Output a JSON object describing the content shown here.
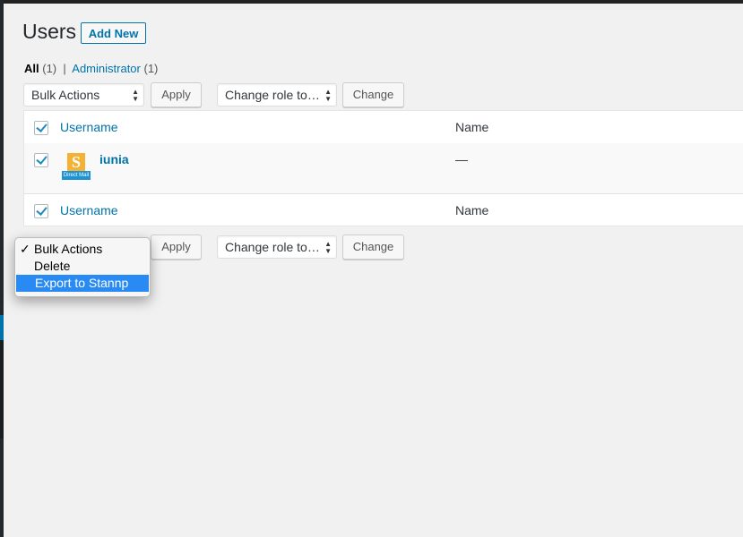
{
  "header": {
    "title": "Users",
    "add_new_label": "Add New"
  },
  "filters": {
    "all_label": "All",
    "all_count": "(1)",
    "separator": "|",
    "admin_label": "Administrator",
    "admin_count": "(1)"
  },
  "top_actions": {
    "bulk_select_value": "Bulk Actions",
    "apply_label": "Apply",
    "role_select_value": "Change role to…",
    "change_label": "Change"
  },
  "table": {
    "columns": {
      "username": "Username",
      "name": "Name"
    },
    "rows": [
      {
        "username": "iunia",
        "name": "—",
        "avatar_letter": "S",
        "avatar_caption": "Direct Mail"
      }
    ]
  },
  "bottom_actions": {
    "apply_label": "Apply",
    "role_select_value": "Change role to…",
    "change_label": "Change"
  },
  "bulk_dropdown": {
    "check_mark": "✓",
    "options": [
      "Bulk Actions",
      "Delete",
      "Export to Stannp"
    ],
    "selected": "Bulk Actions",
    "highlighted": "Export to Stannp"
  },
  "colors": {
    "accent": "#0073aa",
    "highlight": "#2a8af4",
    "avatar_orange": "#f5b133",
    "avatar_blue": "#1d93d2"
  }
}
